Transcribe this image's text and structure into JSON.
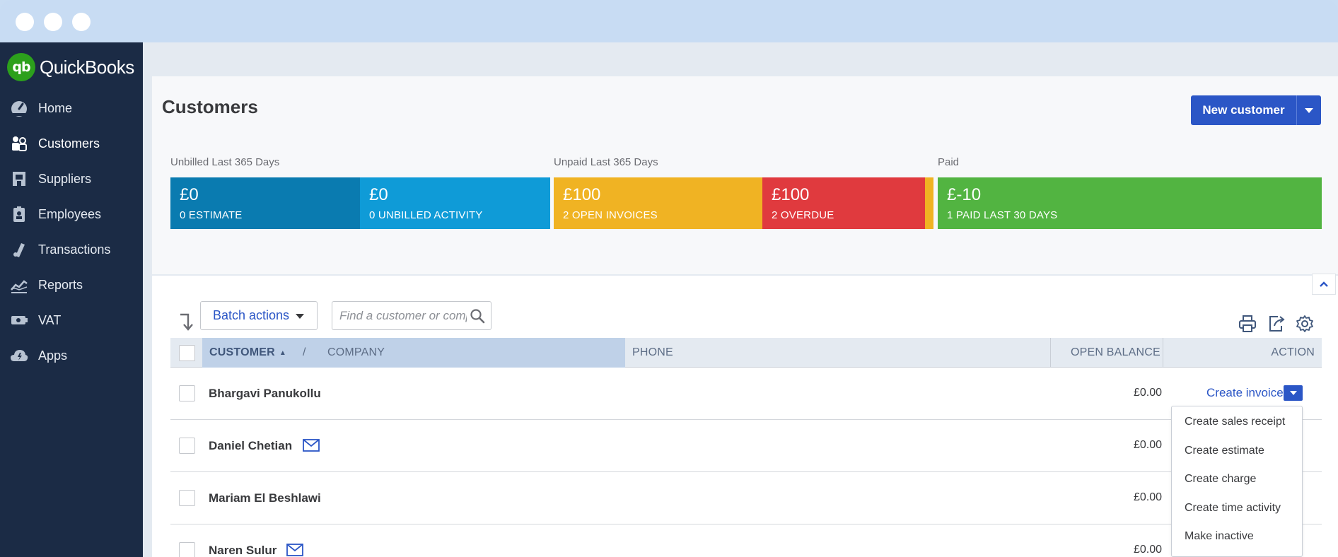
{
  "app": {
    "name": "QuickBooks",
    "logo_mark": "qb"
  },
  "sidebar": {
    "items": [
      {
        "label": "Home",
        "icon": "dashboard-icon"
      },
      {
        "label": "Customers",
        "icon": "customers-icon",
        "active": true
      },
      {
        "label": "Suppliers",
        "icon": "suppliers-icon"
      },
      {
        "label": "Employees",
        "icon": "employees-icon"
      },
      {
        "label": "Transactions",
        "icon": "transactions-icon"
      },
      {
        "label": "Reports",
        "icon": "reports-icon"
      },
      {
        "label": "VAT",
        "icon": "vat-icon"
      },
      {
        "label": "Apps",
        "icon": "apps-icon"
      }
    ]
  },
  "header": {
    "title": "Customers",
    "new_button": "New customer"
  },
  "summary": {
    "unbilled_label": "Unbilled Last 365 Days",
    "unpaid_label": "Unpaid Last 365 Days",
    "paid_label": "Paid",
    "tiles": [
      {
        "amount": "£0",
        "caption": "0 ESTIMATE",
        "color": "#0a7bb0"
      },
      {
        "amount": "£0",
        "caption": "0 UNBILLED ACTIVITY",
        "color": "#0f9bd7"
      },
      {
        "amount": "£100",
        "caption": "2 OPEN INVOICES",
        "color": "#f0b323"
      },
      {
        "amount": "£100",
        "caption": "2 OVERDUE",
        "color": "#e03a3e"
      },
      {
        "amount": "£-10",
        "caption": "1 PAID LAST 30 DAYS",
        "color": "#52b441"
      }
    ]
  },
  "toolbar": {
    "batch_actions": "Batch actions",
    "search_placeholder": "Find a customer or company"
  },
  "table": {
    "headers": {
      "customer": "CUSTOMER",
      "sort_indicator": "▲",
      "separator": "/",
      "company": "COMPANY",
      "phone": "PHONE",
      "open_balance": "OPEN BALANCE",
      "action": "ACTION"
    },
    "rows": [
      {
        "name": "Bhargavi Panukollu",
        "email_icon": false,
        "balance": "£0.00"
      },
      {
        "name": "Daniel Chetian",
        "email_icon": true,
        "balance": "£0.00"
      },
      {
        "name": "Mariam El Beshlawi",
        "email_icon": false,
        "balance": "£0.00"
      },
      {
        "name": "Naren Sulur",
        "email_icon": true,
        "balance": "£0.00"
      }
    ],
    "row_action": "Create invoice"
  },
  "action_menu": {
    "items": [
      "Create sales receipt",
      "Create estimate",
      "Create charge",
      "Create time activity",
      "Make inactive"
    ]
  },
  "colors": {
    "sidebar": "#1b2b45",
    "accent": "#2b56c6",
    "brand_green": "#2ca01c"
  }
}
